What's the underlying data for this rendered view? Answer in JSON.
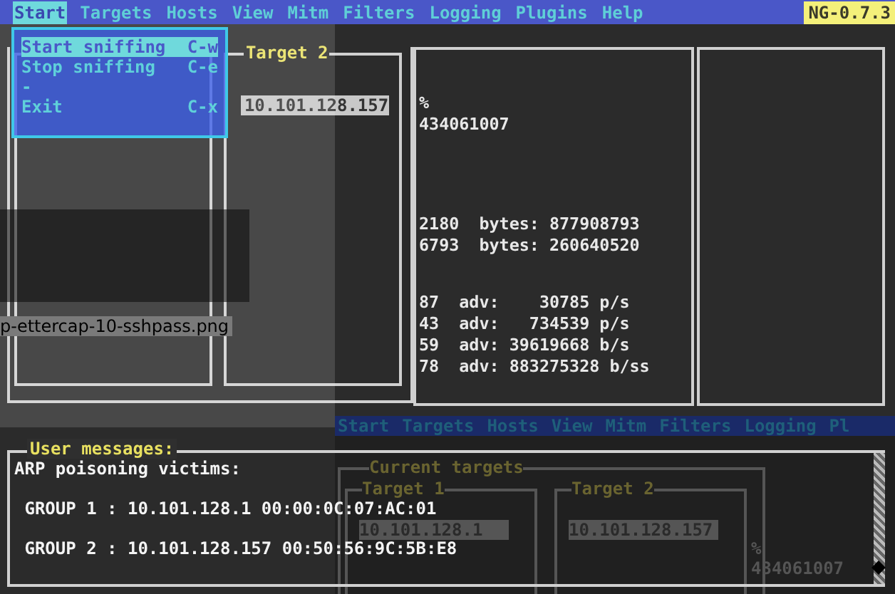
{
  "menu_bar": {
    "items": [
      {
        "label": "Start",
        "selected": true
      },
      {
        "label": "Targets",
        "selected": false
      },
      {
        "label": "Hosts",
        "selected": false
      },
      {
        "label": "View",
        "selected": false
      },
      {
        "label": "Mitm",
        "selected": false
      },
      {
        "label": "Filters",
        "selected": false
      },
      {
        "label": "Logging",
        "selected": false
      },
      {
        "label": "Plugins",
        "selected": false
      },
      {
        "label": "Help",
        "selected": false
      }
    ],
    "version": "NG-0.7.3"
  },
  "start_menu": {
    "items": [
      {
        "kind": "command",
        "label": "Start sniffing",
        "shortcut": "C-w",
        "selected": true
      },
      {
        "kind": "command",
        "label": "Stop sniffing",
        "shortcut": "C-e",
        "selected": false
      },
      {
        "kind": "separator",
        "label": "-"
      },
      {
        "kind": "command",
        "label": "Exit",
        "shortcut": "C-x",
        "selected": false
      }
    ]
  },
  "target_2": {
    "title": "Target 2",
    "address": "10.101.128.157"
  },
  "statistics": {
    "groups": [
      [
        "%",
        "434061007"
      ],
      [
        "2180  bytes: 877908793",
        "6793  bytes: 260640520"
      ],
      [
        "87  adv:    30785 p/s",
        "43  adv:   734539 p/s",
        "59  adv: 39619668 b/s",
        "78  adv: 883275328 b/ss"
      ]
    ]
  },
  "user_messages": {
    "title": "User messages:",
    "lines": [
      "ARP poisoning victims:",
      " GROUP 1 : 10.101.128.1 00:00:0C:07:AC:01",
      " GROUP 2 : 10.101.128.157 00:50:56:9C:5B:E8"
    ]
  },
  "background_file": {
    "caption": "p-ettercap-10-sshpass.png"
  },
  "background_window": {
    "menu_items": [
      "Start",
      "Targets",
      "Hosts",
      "View",
      "Mitm",
      "Filters",
      "Logging",
      "Pl"
    ],
    "panel_title": "Current targets",
    "targets": [
      {
        "title": "Target 1",
        "address": "10.101.128.1"
      },
      {
        "title": "Target 2",
        "address": "10.101.128.157"
      }
    ],
    "stats": [
      "%",
      "434061007"
    ]
  }
}
